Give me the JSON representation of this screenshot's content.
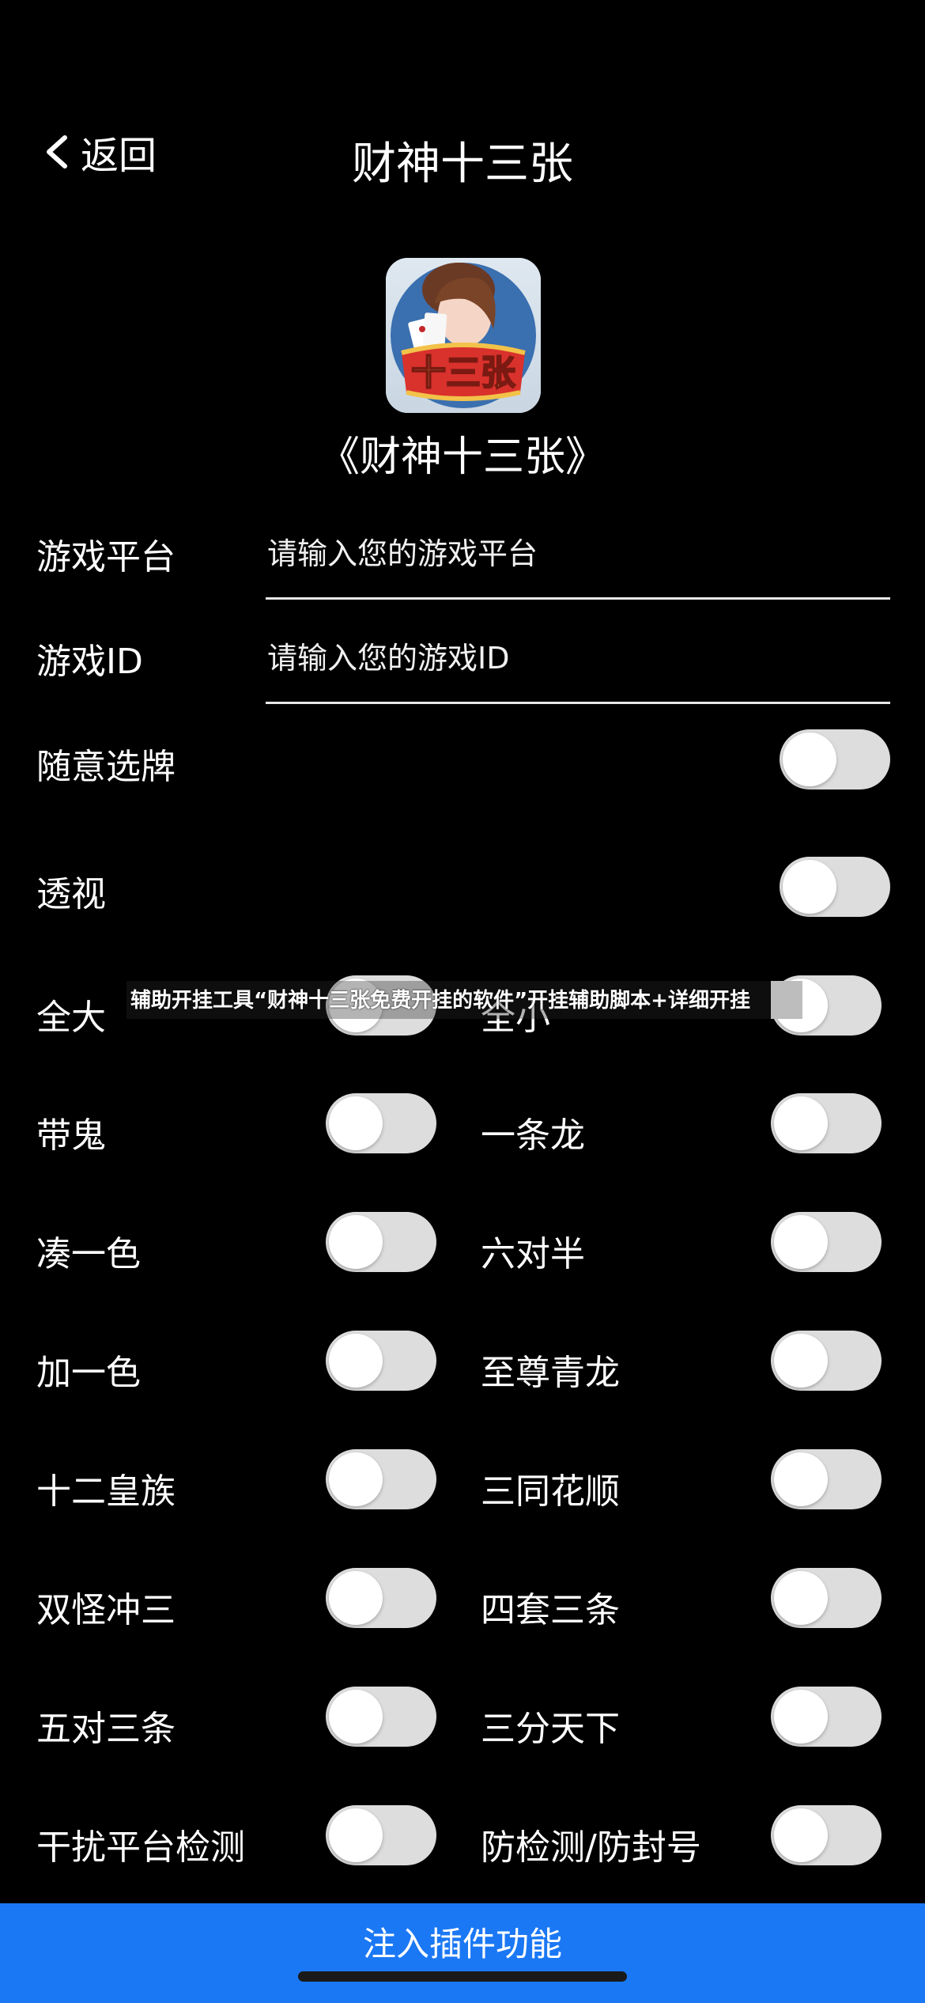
{
  "header": {
    "back_label": "返回",
    "title": "财神十三张"
  },
  "app": {
    "icon_text": "十三张",
    "name": "《财神十三张》"
  },
  "fields": [
    {
      "label": "游戏平台",
      "placeholder": "请输入您的游戏平台"
    },
    {
      "label": "游戏ID",
      "placeholder": "请输入您的游戏ID"
    }
  ],
  "single_toggles": [
    {
      "label": "随意选牌",
      "on": false
    },
    {
      "label": "透视",
      "on": false
    }
  ],
  "toggle_rows": [
    [
      {
        "label": "全大",
        "on": false
      },
      {
        "label": "全小",
        "on": false
      }
    ],
    [
      {
        "label": "带鬼",
        "on": false
      },
      {
        "label": "一条龙",
        "on": false
      }
    ],
    [
      {
        "label": "凑一色",
        "on": false
      },
      {
        "label": "六对半",
        "on": false
      }
    ],
    [
      {
        "label": "加一色",
        "on": false
      },
      {
        "label": "至尊青龙",
        "on": false
      }
    ],
    [
      {
        "label": "十二皇族",
        "on": false
      },
      {
        "label": "三同花顺",
        "on": false
      }
    ],
    [
      {
        "label": "双怪冲三",
        "on": false
      },
      {
        "label": "四套三条",
        "on": false
      }
    ],
    [
      {
        "label": "五对三条",
        "on": false
      },
      {
        "label": "三分天下",
        "on": false
      }
    ],
    [
      {
        "label": "干扰平台检测",
        "on": false
      },
      {
        "label": "防检测/防封号",
        "on": false
      }
    ]
  ],
  "overlay": {
    "caption": "辅助开挂工具“财神十三张免费开挂的软件”开挂辅助脚本+详细开挂"
  },
  "footer": {
    "inject_label": "注入插件功能"
  },
  "colors": {
    "background": "#000000",
    "toggle_track": "#dddddd",
    "toggle_knob": "#ffffff",
    "primary_button": "#1b78f5"
  }
}
